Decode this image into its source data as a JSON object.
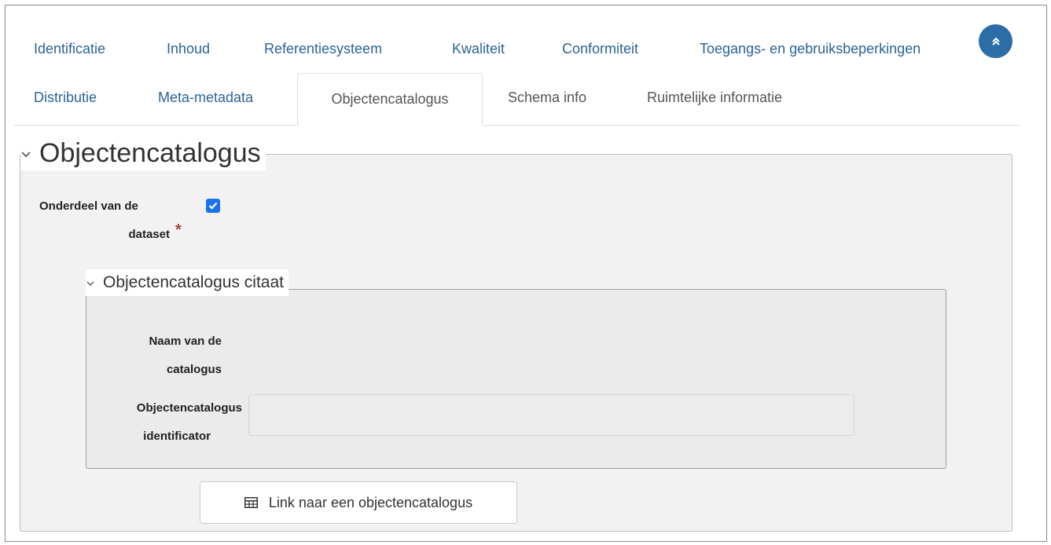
{
  "tabs": {
    "row1": [
      {
        "label": "Identificatie"
      },
      {
        "label": "Inhoud"
      },
      {
        "label": "Referentiesysteem"
      },
      {
        "label": "Kwaliteit"
      },
      {
        "label": "Conformiteit"
      },
      {
        "label": "Toegangs- en gebruiksbeperkingen"
      }
    ],
    "row2": [
      {
        "label": "Distributie"
      },
      {
        "label": "Meta-metadata"
      },
      {
        "label": "Objectencatalogus",
        "active": true
      },
      {
        "label": "Schema info"
      },
      {
        "label": "Ruimtelijke informatie"
      }
    ],
    "scroll_top_icon": "double-chevron-up-icon"
  },
  "section": {
    "title": "Objectencatalogus",
    "field_part_of_dataset": {
      "label_line1": "Onderdeel van de",
      "label_line2": "dataset",
      "required_mark": "*",
      "checked": true
    },
    "subsection": {
      "title": "Objectencatalogus citaat",
      "field_name": {
        "label_line1": "Naam van de",
        "label_line2": "catalogus"
      },
      "field_identifier": {
        "label_line1": "Objectencatalogus",
        "label_line2": "identificator",
        "value": ""
      }
    },
    "link_button": {
      "label": "Link naar een objectencatalogus",
      "icon": "table-icon"
    }
  },
  "colors": {
    "link": "#2a6496",
    "accent": "#2b6da6",
    "checkbox": "#1a73e8",
    "required": "#a94442"
  }
}
